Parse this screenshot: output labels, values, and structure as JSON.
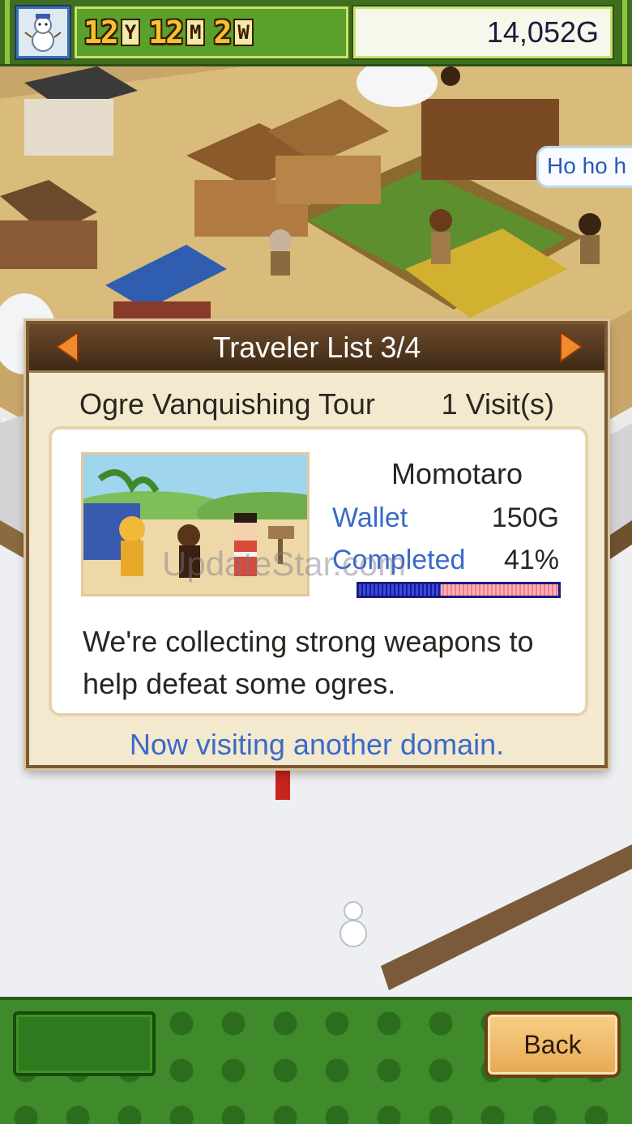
{
  "hud": {
    "season_icon": "snowman-icon",
    "year_value": "12",
    "year_unit": "Y",
    "month_value": "12",
    "month_unit": "M",
    "week_value": "2",
    "week_unit": "W",
    "money": "14,052G"
  },
  "speech_bubble": "Ho ho h",
  "dialog": {
    "title": "Traveler List 3/4",
    "tour_name": "Ogre Vanquishing Tour",
    "visits": "1 Visit(s)",
    "traveler_name": "Momotaro",
    "wallet_label": "Wallet",
    "wallet_value": "150G",
    "completed_label": "Completed",
    "completed_value": "41%",
    "completed_fraction": 0.41,
    "description": "We're collecting strong weapons to help defeat some ogres.",
    "status": "Now visiting another domain."
  },
  "watermark": "UpdateStar.com",
  "bottom": {
    "back_label": "Back"
  },
  "colors": {
    "hud_green": "#3f6e1e",
    "accent_blue": "#3a6ac8",
    "dialog_bg": "#f3e9cf",
    "progress_fill": "#141c9a",
    "progress_empty": "#ef7f8c"
  }
}
